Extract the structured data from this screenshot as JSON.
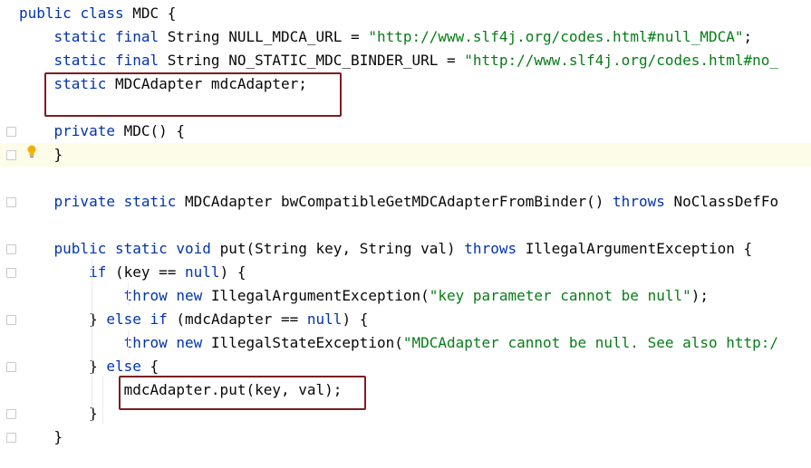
{
  "editor": {
    "lines": [
      {
        "tokens": [
          {
            "t": "public ",
            "c": "kw"
          },
          {
            "t": "class ",
            "c": "kw"
          },
          {
            "t": "MDC {",
            "c": ""
          }
        ]
      },
      {
        "tokens": [
          {
            "t": "    static ",
            "c": "kw"
          },
          {
            "t": "final ",
            "c": "kw"
          },
          {
            "t": "String NULL_MDCA_URL = ",
            "c": ""
          },
          {
            "t": "\"http://www.slf4j.org/codes.html#null_MDCA\"",
            "c": "str"
          },
          {
            "t": ";",
            "c": ""
          }
        ]
      },
      {
        "tokens": [
          {
            "t": "    static ",
            "c": "kw"
          },
          {
            "t": "final ",
            "c": "kw"
          },
          {
            "t": "String NO_STATIC_MDC_BINDER_URL = ",
            "c": ""
          },
          {
            "t": "\"http://www.slf4j.org/codes.html#no_",
            "c": "str"
          }
        ]
      },
      {
        "tokens": [
          {
            "t": "    static ",
            "c": "kw"
          },
          {
            "t": "MDCAdapter mdcAdapter;",
            "c": ""
          }
        ]
      },
      {
        "tokens": []
      },
      {
        "tokens": [
          {
            "t": "    private ",
            "c": "kw"
          },
          {
            "t": "MDC() {",
            "c": ""
          }
        ]
      },
      {
        "tokens": [
          {
            "t": "    }",
            "c": ""
          }
        ],
        "highlight": true
      },
      {
        "tokens": []
      },
      {
        "tokens": [
          {
            "t": "    private ",
            "c": "kw"
          },
          {
            "t": "static ",
            "c": "kw"
          },
          {
            "t": "MDCAdapter bwCompatibleGetMDCAdapterFromBinder() ",
            "c": ""
          },
          {
            "t": "throws ",
            "c": "kw"
          },
          {
            "t": "NoClassDefFo",
            "c": ""
          }
        ]
      },
      {
        "tokens": []
      },
      {
        "tokens": [
          {
            "t": "    public ",
            "c": "kw"
          },
          {
            "t": "static ",
            "c": "kw"
          },
          {
            "t": "void ",
            "c": "kw"
          },
          {
            "t": "put(String key, String val) ",
            "c": ""
          },
          {
            "t": "throws ",
            "c": "kw"
          },
          {
            "t": "IllegalArgumentException {",
            "c": ""
          }
        ]
      },
      {
        "tokens": [
          {
            "t": "        if ",
            "c": "kw"
          },
          {
            "t": "(key == ",
            "c": ""
          },
          {
            "t": "null",
            "c": "kw"
          },
          {
            "t": ") {",
            "c": ""
          }
        ]
      },
      {
        "tokens": [
          {
            "t": "            throw ",
            "c": "kw"
          },
          {
            "t": "new ",
            "c": "kw"
          },
          {
            "t": "IllegalArgumentException(",
            "c": ""
          },
          {
            "t": "\"key parameter cannot be null\"",
            "c": "str"
          },
          {
            "t": ");",
            "c": ""
          }
        ]
      },
      {
        "tokens": [
          {
            "t": "        } ",
            "c": ""
          },
          {
            "t": "else ",
            "c": "kw"
          },
          {
            "t": "if ",
            "c": "kw"
          },
          {
            "t": "(mdcAdapter == ",
            "c": ""
          },
          {
            "t": "null",
            "c": "kw"
          },
          {
            "t": ") {",
            "c": ""
          }
        ]
      },
      {
        "tokens": [
          {
            "t": "            throw ",
            "c": "kw"
          },
          {
            "t": "new ",
            "c": "kw"
          },
          {
            "t": "IllegalStateException(",
            "c": ""
          },
          {
            "t": "\"MDCAdapter cannot be null. See also http:/",
            "c": "str"
          }
        ]
      },
      {
        "tokens": [
          {
            "t": "        } ",
            "c": ""
          },
          {
            "t": "else ",
            "c": "kw"
          },
          {
            "t": "{",
            "c": ""
          }
        ]
      },
      {
        "tokens": [
          {
            "t": "            mdcAdapter.put(key, val);",
            "c": ""
          }
        ]
      },
      {
        "tokens": [
          {
            "t": "        }",
            "c": ""
          }
        ]
      },
      {
        "tokens": [
          {
            "t": "    }",
            "c": ""
          }
        ]
      }
    ],
    "colors": {
      "keyword": "#0033b3",
      "string": "#067d17",
      "text": "#080808",
      "highlight_bg": "#fdfce8",
      "annotation_box": "#7a1f1f"
    },
    "icons": [
      "fold-icon",
      "intention-bulb-icon"
    ]
  }
}
